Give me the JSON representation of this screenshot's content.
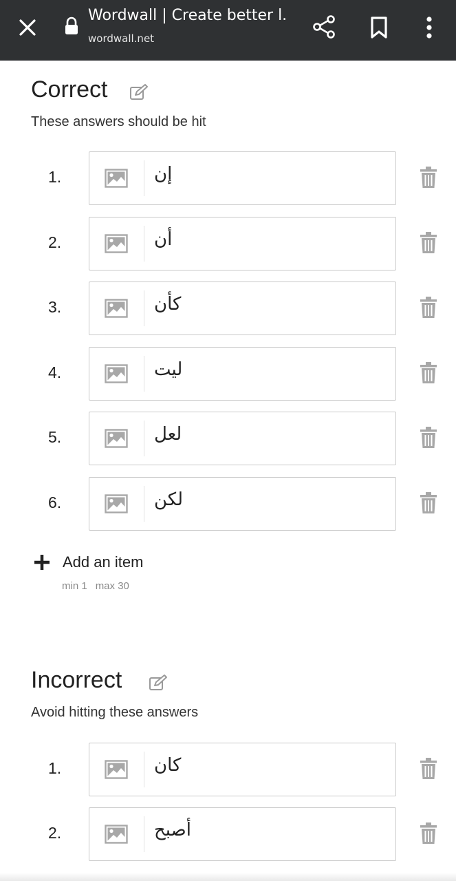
{
  "browser": {
    "title": "Wordwall | Create better l...",
    "url": "wordwall.net"
  },
  "correct": {
    "title": "Correct",
    "description": "These answers should be hit",
    "items": [
      {
        "number": "1.",
        "text": "إن"
      },
      {
        "number": "2.",
        "text": "أن"
      },
      {
        "number": "3.",
        "text": "كأن"
      },
      {
        "number": "4.",
        "text": "ليت"
      },
      {
        "number": "5.",
        "text": "لعل"
      },
      {
        "number": "6.",
        "text": "لكن"
      }
    ],
    "add_label": "Add an item",
    "min_label": "min 1",
    "max_label": "max 30"
  },
  "incorrect": {
    "title": "Incorrect",
    "description": "Avoid hitting these answers",
    "items": [
      {
        "number": "1.",
        "text": "كان"
      },
      {
        "number": "2.",
        "text": "أصبح"
      }
    ]
  },
  "icons": {
    "close": "close-icon",
    "lock": "lock-icon",
    "share": "share-icon",
    "bookmark": "bookmark-icon",
    "more": "more-vert-icon",
    "edit": "edit-icon",
    "image": "image-icon",
    "delete": "trash-icon",
    "add": "plus-icon"
  },
  "colors": {
    "topbar": "#2f3133",
    "icon_grey": "#a8a8a8",
    "border": "#c9c9c9"
  }
}
